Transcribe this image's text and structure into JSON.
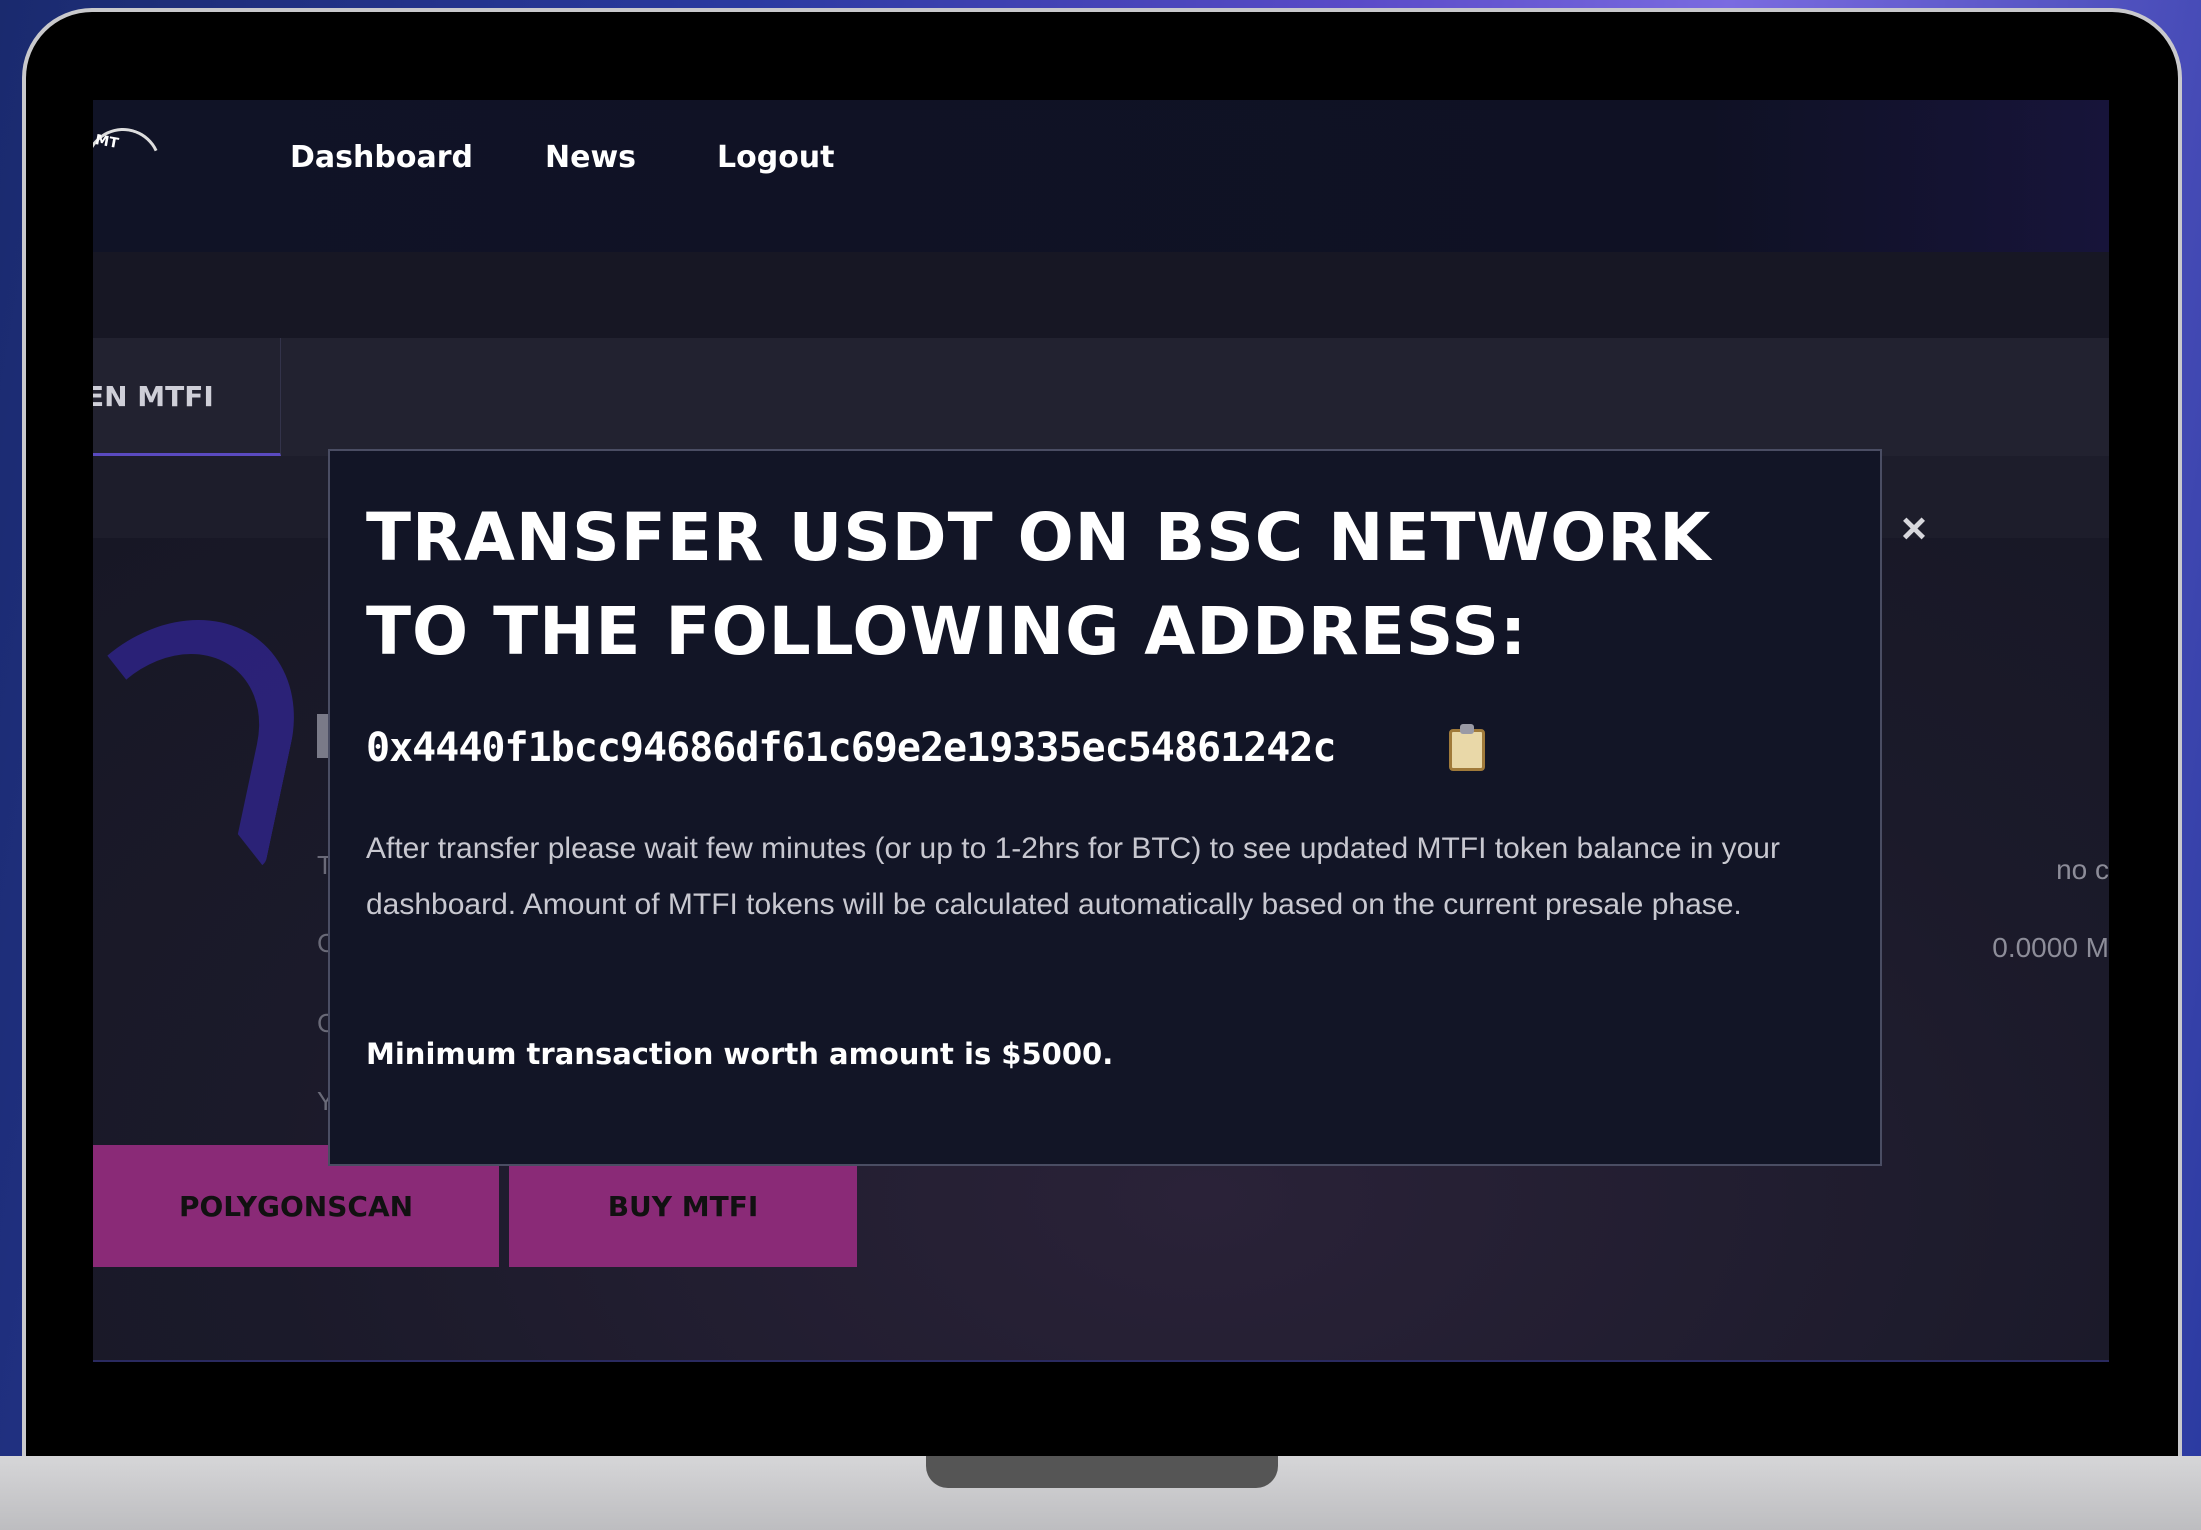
{
  "nav": {
    "logo_text": "MT",
    "links": [
      "Dashboard",
      "News",
      "Logout"
    ]
  },
  "tabs": {
    "active_label": "EN MTFI"
  },
  "background": {
    "right_values": [
      "no c",
      "0.0000 M"
    ],
    "left_letters": [
      "T",
      "C",
      "C",
      "Y"
    ],
    "buttons": [
      "POLYGONSCAN",
      "BUY MTFI"
    ]
  },
  "modal": {
    "title": "TRANSFER USDT ON BSC NETWORK TO THE FOLLOWING ADDRESS:",
    "close_symbol": "×",
    "address": "0x4440f1bcc94686df61c69e2e19335ec54861242c",
    "copy_icon": "clipboard-icon",
    "info": "After transfer please wait few minutes (or up to 1-2hrs for BTC) to see updated MTFI token balance in your dashboard. Amount of MTFI tokens will be calculated automatically based on the current presale phase.",
    "minimum": "Minimum transaction worth amount is $5000."
  },
  "colors": {
    "button_bg": "#8a2a77",
    "modal_bg": "#121526",
    "screen_bg": "#181826"
  }
}
